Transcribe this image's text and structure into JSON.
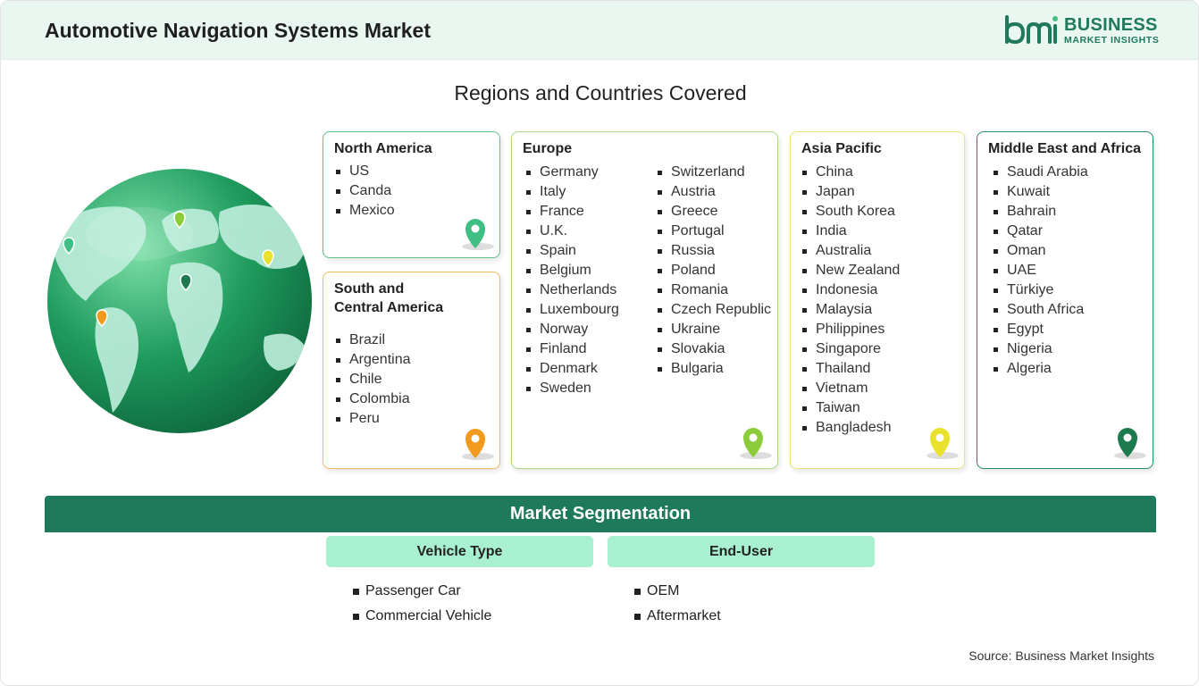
{
  "header": {
    "title": "Automotive Navigation Systems Market"
  },
  "logo": {
    "line1": "BUSINESS",
    "line2": "MARKET INSIGHTS"
  },
  "section_title": "Regions and Countries Covered",
  "regions": [
    {
      "name": "North America",
      "countries": [
        "US",
        "Canda",
        "Mexico"
      ],
      "pin_color": "#3fbf84"
    },
    {
      "name": "South and\nCentral America",
      "countries": [
        "Brazil",
        "Argentina",
        "Chile",
        "Colombia",
        "Peru"
      ],
      "pin_color": "#f29a1e"
    },
    {
      "name": "Europe",
      "countries_col1": [
        "Germany",
        "Italy",
        "France",
        "U.K.",
        "Spain",
        "Belgium",
        "Netherlands",
        "Luxembourg",
        "Norway",
        "Finland",
        "Denmark",
        "Sweden"
      ],
      "countries_col2": [
        "Switzerland",
        "Austria",
        "Greece",
        "Portugal",
        "Russia",
        "Poland",
        "Romania",
        "Czech Republic",
        "Ukraine",
        "Slovakia",
        "Bulgaria"
      ],
      "pin_color": "#8ccc3a"
    },
    {
      "name": "Asia Pacific",
      "countries": [
        "China",
        "Japan",
        "South Korea",
        "India",
        "Australia",
        "New Zealand",
        "Indonesia",
        "Malaysia",
        "Philippines",
        "Singapore",
        "Thailand",
        "Vietnam",
        "Taiwan",
        "Bangladesh"
      ],
      "pin_color": "#e8e22c"
    },
    {
      "name": "Middle East and Africa",
      "countries": [
        "Saudi Arabia",
        "Kuwait",
        "Bahrain",
        "Qatar",
        "Oman",
        "UAE",
        "Türkiye",
        "South Africa",
        "Egypt",
        "Nigeria",
        "Algeria"
      ],
      "pin_color": "#1d7a4f"
    }
  ],
  "segmentation": {
    "title": "Market Segmentation",
    "groups": [
      {
        "name": "Vehicle Type",
        "items": [
          "Passenger Car",
          "Commercial Vehicle"
        ]
      },
      {
        "name": "End-User",
        "items": [
          "OEM",
          "Aftermarket"
        ]
      }
    ]
  },
  "source": "Source: Business Market Insights",
  "colors": {
    "brand": "#1e7a5a",
    "header_bg": "#e9f7f0",
    "seg_head_bg": "#a9f0d1"
  }
}
